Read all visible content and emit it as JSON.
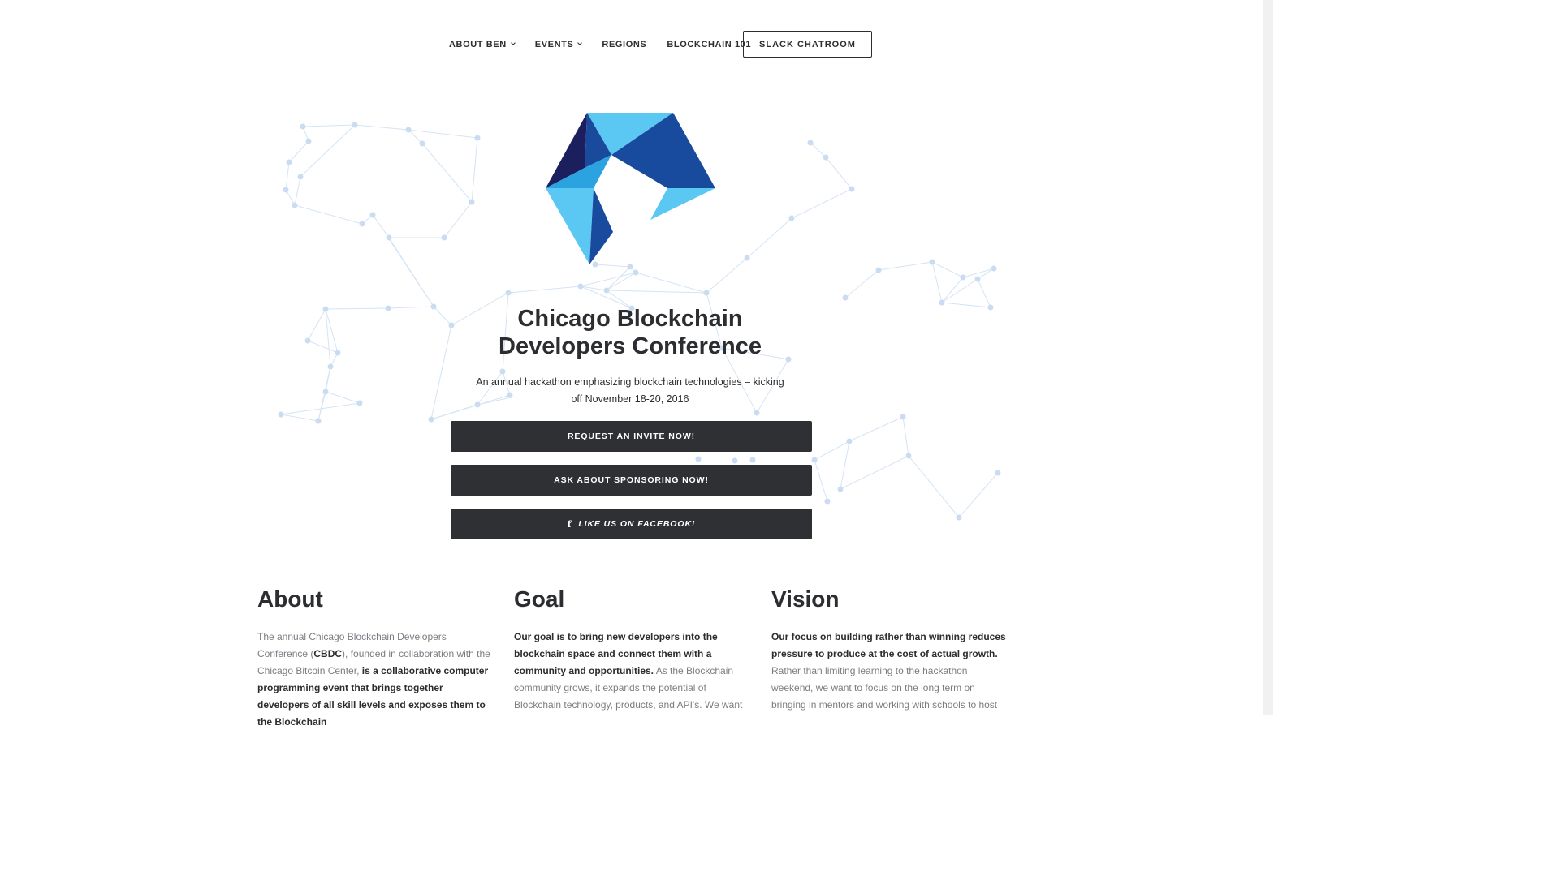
{
  "nav": {
    "items": [
      {
        "label": "ABOUT BEN",
        "has_dropdown": true
      },
      {
        "label": "EVENTS",
        "has_dropdown": true
      },
      {
        "label": "REGIONS",
        "has_dropdown": false
      },
      {
        "label": "BLOCKCHAIN 101",
        "has_dropdown": false
      }
    ],
    "cta": "SLACK CHATROOM"
  },
  "hero": {
    "title": "Chicago Blockchain Developers Conference",
    "subtitle": "An annual hackathon emphasizing blockchain technologies – kicking off November 18-20, 2016",
    "buttons": {
      "invite": "REQUEST AN INVITE NOW!",
      "sponsor": "ASK ABOUT SPONSORING NOW!",
      "facebook": "LIKE US ON FACEBOOK!"
    },
    "facebook_icon": "facebook-icon"
  },
  "colors": {
    "logo_navy": "#1b1f5e",
    "logo_blue": "#184b9d",
    "logo_light": "#5bc8f3",
    "logo_mid": "#2aa3e0",
    "button_bg": "#2f3033",
    "network": "#c9dcf2"
  },
  "sections": {
    "about": {
      "heading": "About",
      "t1": "The annual Chicago Blockchain Developers Conference (",
      "t2": "CBDC",
      "t3": "), founded in collaboration with the Chicago Bitcoin Center, ",
      "t4": "is a collaborative computer programming event that brings together developers of all skill levels and exposes them to the Blockchain"
    },
    "goal": {
      "heading": "Goal",
      "t1": "Our goal is to bring new developers into the blockchain space and connect them with a community and opportunities.",
      "t2": " As the Blockchain community grows, it expands the potential of Blockchain technology, products, and API's. We want"
    },
    "vision": {
      "heading": "Vision",
      "t1": "Our focus on building rather than winning reduces pressure to produce at the cost of actual growth.",
      "t2": " Rather than limiting learning to the hackathon weekend, we want to focus on the long term on bringing in mentors and working with schools to host"
    }
  }
}
